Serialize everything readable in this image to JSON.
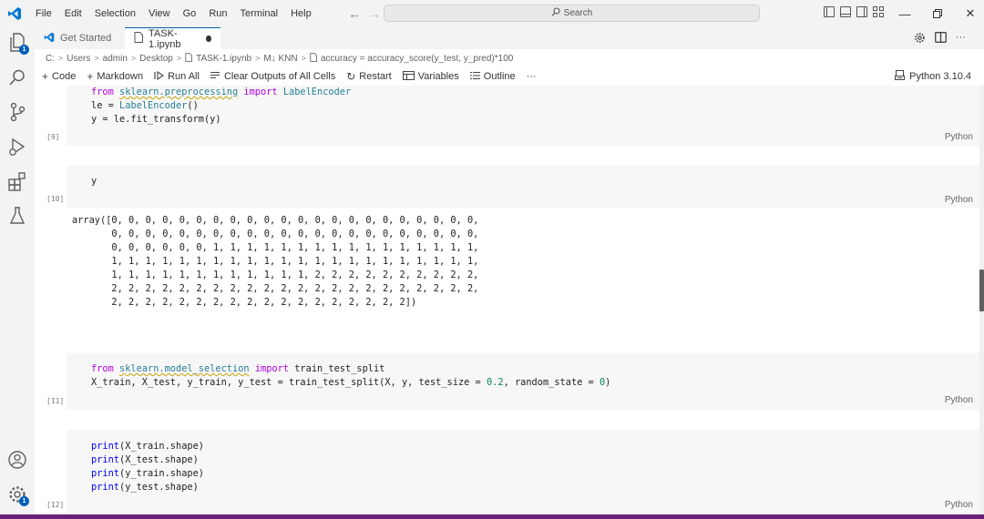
{
  "menu": [
    "File",
    "Edit",
    "Selection",
    "View",
    "Go",
    "Run",
    "Terminal",
    "Help"
  ],
  "search": {
    "label": "Search"
  },
  "tabs": [
    {
      "label": "Get Started",
      "icon": "vscode-icon"
    },
    {
      "label": "TASK-1.ipynb",
      "icon": "file-icon",
      "dirty": true
    }
  ],
  "breadcrumb": [
    "C:",
    "Users",
    "admin",
    "Desktop",
    "TASK-1.ipynb",
    "M↓ KNN",
    "accuracy = accuracy_score(y_test, y_pred)*100"
  ],
  "toolbar": {
    "code": "Code",
    "markdown": "Markdown",
    "run_all": "Run All",
    "clear_outputs": "Clear Outputs of All Cells",
    "restart": "Restart",
    "variables": "Variables",
    "outline": "Outline",
    "more": "···",
    "kernel": "Python 3.10.4"
  },
  "cells": [
    {
      "exec": "[9]",
      "lang": "Python"
    },
    {
      "exec": "[10]",
      "lang": "Python",
      "output": "array([0, 0, 0, 0, 0, 0, 0, 0, 0, 0, 0, 0, 0, 0, 0, 0, 0, 0, 0, 0, 0, 0,\n       0, 0, 0, 0, 0, 0, 0, 0, 0, 0, 0, 0, 0, 0, 0, 0, 0, 0, 0, 0, 0, 0,\n       0, 0, 0, 0, 0, 0, 1, 1, 1, 1, 1, 1, 1, 1, 1, 1, 1, 1, 1, 1, 1, 1,\n       1, 1, 1, 1, 1, 1, 1, 1, 1, 1, 1, 1, 1, 1, 1, 1, 1, 1, 1, 1, 1, 1,\n       1, 1, 1, 1, 1, 1, 1, 1, 1, 1, 1, 1, 2, 2, 2, 2, 2, 2, 2, 2, 2, 2,\n       2, 2, 2, 2, 2, 2, 2, 2, 2, 2, 2, 2, 2, 2, 2, 2, 2, 2, 2, 2, 2, 2,\n       2, 2, 2, 2, 2, 2, 2, 2, 2, 2, 2, 2, 2, 2, 2, 2, 2, 2])"
    },
    {
      "exec": "[11]",
      "lang": "Python"
    },
    {
      "exec": "[12]",
      "lang": "Python"
    }
  ],
  "colors": {
    "accent": "#005fb8",
    "statusbar": "#68217a"
  }
}
